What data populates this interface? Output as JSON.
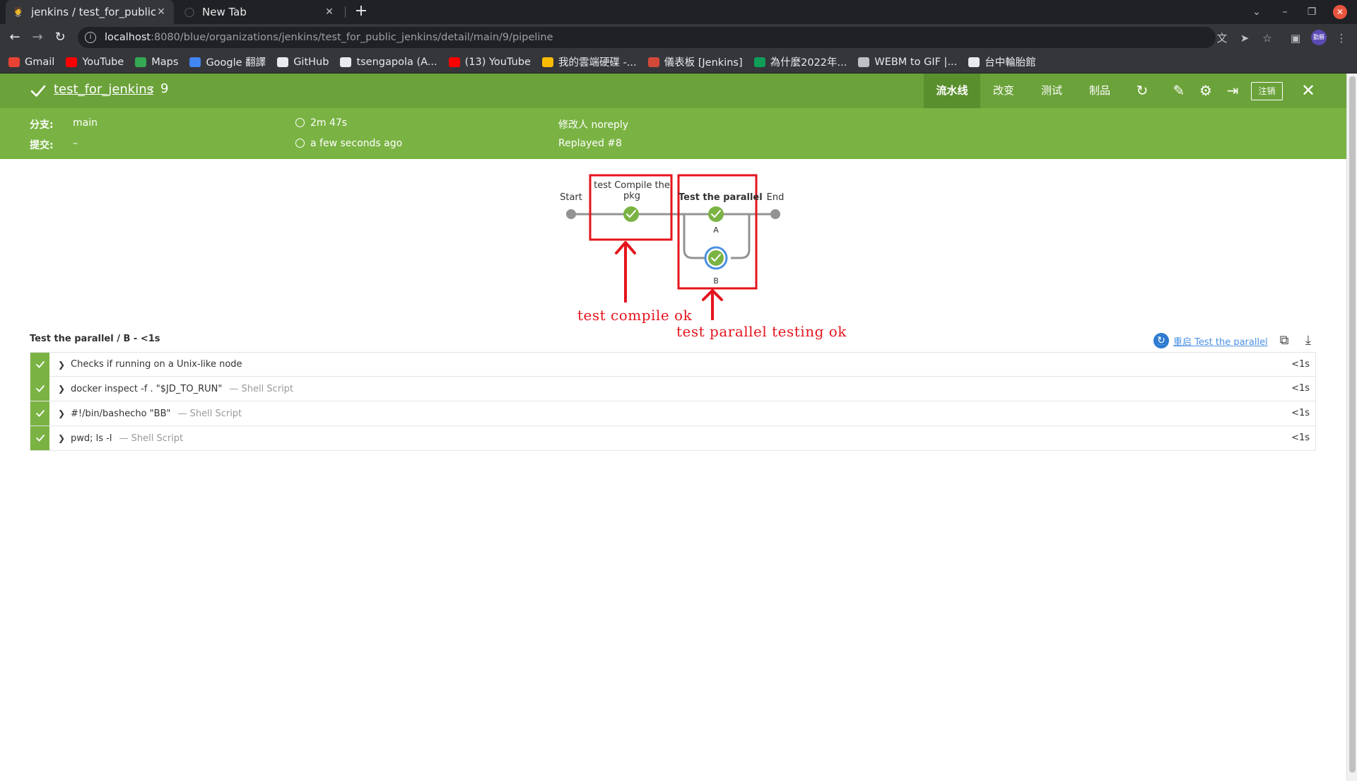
{
  "browser": {
    "tabs": [
      {
        "title": "jenkins / test_for_public_",
        "active": true
      },
      {
        "title": "New Tab",
        "active": false
      }
    ],
    "url_host": "localhost",
    "url_rest": ":8080/blue/organizations/jenkins/test_for_public_jenkins/detail/main/9/pipeline",
    "avatar_text": "勤勝",
    "bookmarks": [
      {
        "label": "Gmail",
        "icon": "gmail-icon",
        "color": "#ea4335"
      },
      {
        "label": "YouTube",
        "icon": "youtube-icon",
        "color": "#ff0000"
      },
      {
        "label": "Maps",
        "icon": "maps-icon",
        "color": "#34a853"
      },
      {
        "label": "Google 翻譯",
        "icon": "translate-icon",
        "color": "#4285f4"
      },
      {
        "label": "GitHub",
        "icon": "github-icon",
        "color": "#e8eaed"
      },
      {
        "label": "tsengapola (A...",
        "icon": "github-icon",
        "color": "#e8eaed"
      },
      {
        "label": "(13) YouTube",
        "icon": "youtube-icon",
        "color": "#ff0000"
      },
      {
        "label": "我的雲端硬碟 -...",
        "icon": "drive-icon",
        "color": "#fbbc04"
      },
      {
        "label": "儀表板 [Jenkins]",
        "icon": "jenkins-icon",
        "color": "#d24939"
      },
      {
        "label": "為什麼2022年...",
        "icon": "sheet-icon",
        "color": "#0f9d58"
      },
      {
        "label": "WEBM to GIF |...",
        "icon": "cloud-icon",
        "color": "#bdc1c6"
      },
      {
        "label": "台中輪胎館",
        "icon": "tire-icon",
        "color": "#e8eaed"
      }
    ]
  },
  "header": {
    "pipeline_name": "test_for_jenkins",
    "run_number": "9",
    "tabs": [
      "流水线",
      "改变",
      "测试",
      "制品"
    ],
    "logout_label": "注销",
    "colors": {
      "topbar": "#6ba23a",
      "summary": "#7ab343",
      "success": "#7ab343"
    }
  },
  "summary": {
    "branch_label": "分支:",
    "branch_value": "main",
    "commit_label": "提交:",
    "commit_value": "–",
    "duration": "2m 47s",
    "time_ago": "a few seconds ago",
    "changes": "修改人 noreply",
    "replayed": "Replayed #8"
  },
  "graph": {
    "start_label": "Start",
    "stage1_label_line1": "test Compile the",
    "stage1_label_line2": "pkg",
    "stage2_label": "Test the parallel",
    "branch_a": "A",
    "branch_b": "B",
    "end_label": "End",
    "annotation_compile": "test  compile  ok",
    "annotation_parallel": "test  parallel  testing  ok"
  },
  "steps": {
    "title": "Test the parallel / B - <1s",
    "restart_label": "重启 Test the parallel",
    "items": [
      {
        "desc": "Checks if running on a Unix-like node",
        "kind": "",
        "duration": "<1s"
      },
      {
        "desc": "docker inspect -f . \"$JD_TO_RUN\"",
        "kind": "— Shell Script",
        "duration": "<1s"
      },
      {
        "desc": "#!/bin/bashecho \"BB\"",
        "kind": "— Shell Script",
        "duration": "<1s"
      },
      {
        "desc": "pwd; ls -l",
        "kind": "— Shell Script",
        "duration": "<1s"
      }
    ]
  }
}
